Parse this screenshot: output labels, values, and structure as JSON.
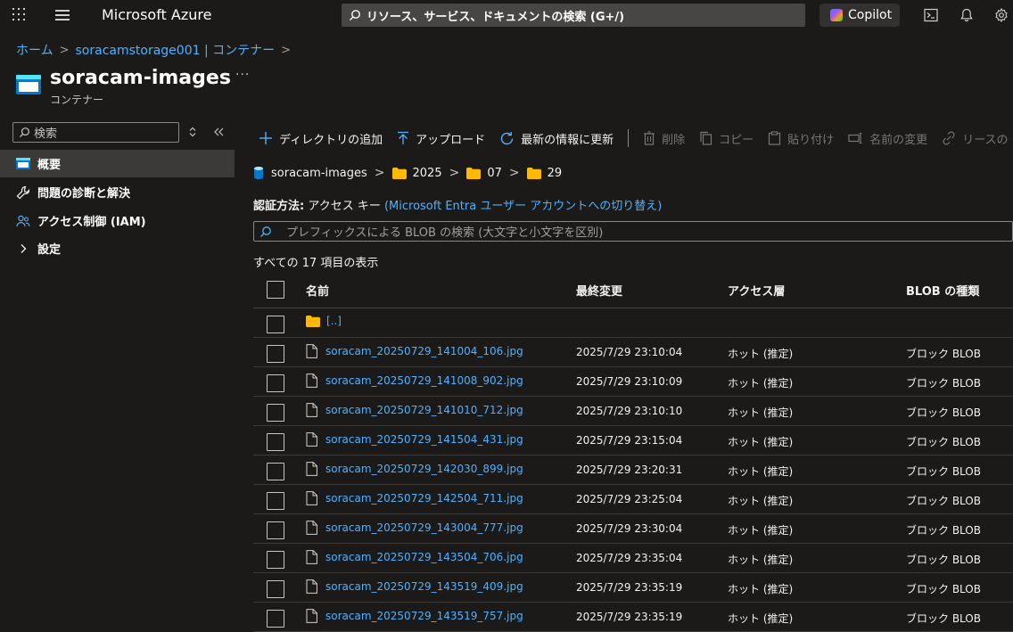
{
  "app": {
    "brand": "Microsoft Azure",
    "search_placeholder": "リソース、サービス、ドキュメントの検索 (G+/)",
    "copilot_label": "Copilot"
  },
  "breadcrumb": [
    {
      "label": "ホーム"
    },
    {
      "label": "soracamstorage001 | コンテナー"
    }
  ],
  "page": {
    "title": "soracam-images",
    "subtitle": "コンテナー",
    "more": "···"
  },
  "sidebar": {
    "search_placeholder": "検索",
    "items": [
      {
        "label": "概要",
        "icon": "container-icon",
        "active": true
      },
      {
        "label": "問題の診断と解決",
        "icon": "wrench-icon"
      },
      {
        "label": "アクセス制御 (IAM)",
        "icon": "people-icon"
      },
      {
        "label": "設定",
        "icon": "chevron-right-icon"
      }
    ]
  },
  "toolbar": {
    "add_directory": "ディレクトリの追加",
    "upload": "アップロード",
    "refresh": "最新の情報に更新",
    "delete": "削除",
    "copy": "コピー",
    "paste": "貼り付け",
    "rename": "名前の変更",
    "lease": "リースの"
  },
  "path": {
    "container": "soracam-images",
    "folders": [
      "2025",
      "07",
      "29"
    ]
  },
  "auth": {
    "label": "認証方法:",
    "value": "アクセス キー",
    "switch_link": "(Microsoft Entra ユーザー アカウントへの切り替え)"
  },
  "blob_search": {
    "placeholder": "プレフィックスによる BLOB の検索 (大文字と小文字を区別)"
  },
  "count_text": "すべての 17 項目の表示",
  "table": {
    "headers": {
      "name": "名前",
      "modified": "最終変更",
      "tier": "アクセス層",
      "type": "BLOB の種類"
    },
    "parent_row": "[..]",
    "rows": [
      {
        "name": "soracam_20250729_141004_106.jpg",
        "modified": "2025/7/29 23:10:04",
        "tier": "ホット (推定)",
        "type": "ブロック BLOB"
      },
      {
        "name": "soracam_20250729_141008_902.jpg",
        "modified": "2025/7/29 23:10:09",
        "tier": "ホット (推定)",
        "type": "ブロック BLOB"
      },
      {
        "name": "soracam_20250729_141010_712.jpg",
        "modified": "2025/7/29 23:10:10",
        "tier": "ホット (推定)",
        "type": "ブロック BLOB"
      },
      {
        "name": "soracam_20250729_141504_431.jpg",
        "modified": "2025/7/29 23:15:04",
        "tier": "ホット (推定)",
        "type": "ブロック BLOB"
      },
      {
        "name": "soracam_20250729_142030_899.jpg",
        "modified": "2025/7/29 23:20:31",
        "tier": "ホット (推定)",
        "type": "ブロック BLOB"
      },
      {
        "name": "soracam_20250729_142504_711.jpg",
        "modified": "2025/7/29 23:25:04",
        "tier": "ホット (推定)",
        "type": "ブロック BLOB"
      },
      {
        "name": "soracam_20250729_143004_777.jpg",
        "modified": "2025/7/29 23:30:04",
        "tier": "ホット (推定)",
        "type": "ブロック BLOB"
      },
      {
        "name": "soracam_20250729_143504_706.jpg",
        "modified": "2025/7/29 23:35:04",
        "tier": "ホット (推定)",
        "type": "ブロック BLOB"
      },
      {
        "name": "soracam_20250729_143519_409.jpg",
        "modified": "2025/7/29 23:35:19",
        "tier": "ホット (推定)",
        "type": "ブロック BLOB"
      },
      {
        "name": "soracam_20250729_143519_757.jpg",
        "modified": "2025/7/29 23:35:19",
        "tier": "ホット (推定)",
        "type": "ブロック BLOB"
      }
    ]
  },
  "colors": {
    "accent": "#4db2ff",
    "folder": "#ffb900",
    "background": "#1b1a19"
  }
}
